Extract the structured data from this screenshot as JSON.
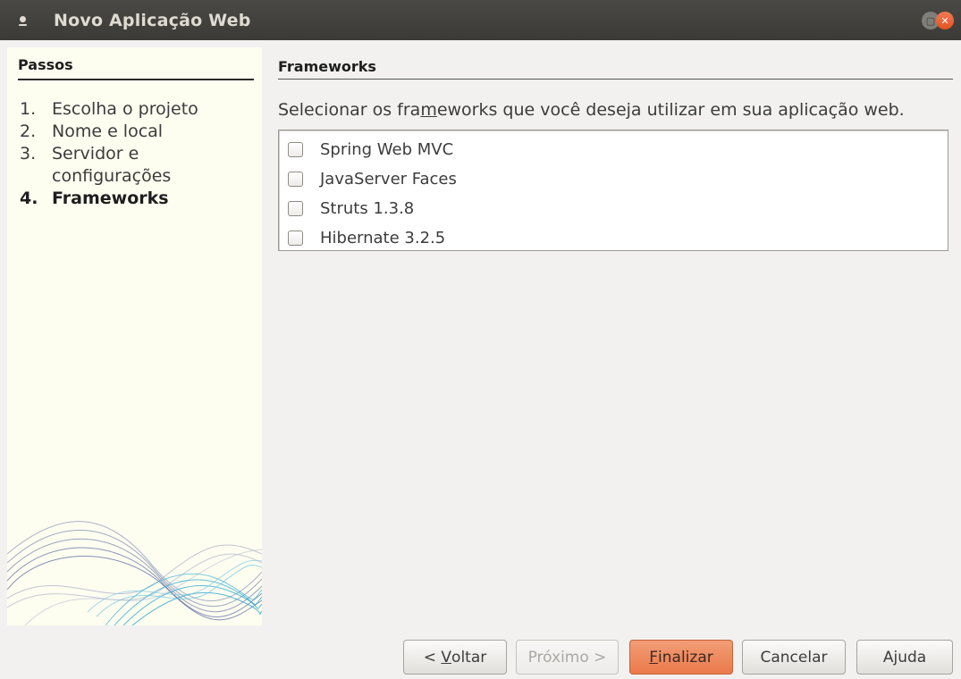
{
  "window": {
    "title": "Novo Aplicação Web",
    "accent_color": "#e95420"
  },
  "steps": {
    "header": "Passos",
    "items": [
      {
        "num": "1.",
        "label": "Escolha o projeto"
      },
      {
        "num": "2.",
        "label": "Nome e local"
      },
      {
        "num": "3.",
        "label": "Servidor e configurações"
      },
      {
        "num": "4.",
        "label": "Frameworks"
      }
    ],
    "current_index": 3
  },
  "main": {
    "header": "Frameworks",
    "instruction_pre": "Selecionar os fra",
    "instruction_mnemonic": "m",
    "instruction_post": "eworks que você deseja utilizar em sua aplicação web.",
    "frameworks": [
      {
        "label": "Spring Web MVC",
        "checked": false
      },
      {
        "label": "JavaServer Faces",
        "checked": false
      },
      {
        "label": "Struts 1.3.8",
        "checked": false
      },
      {
        "label": "Hibernate 3.2.5",
        "checked": false
      }
    ]
  },
  "buttons": {
    "back_pre": "< ",
    "back_mnemonic": "V",
    "back_post": "oltar",
    "next_label": "Próximo >",
    "finish_mnemonic": "F",
    "finish_post": "inalizar",
    "cancel_label": "Cancelar",
    "help_pre": "A",
    "help_mnemonic": "j",
    "help_post": "uda"
  }
}
